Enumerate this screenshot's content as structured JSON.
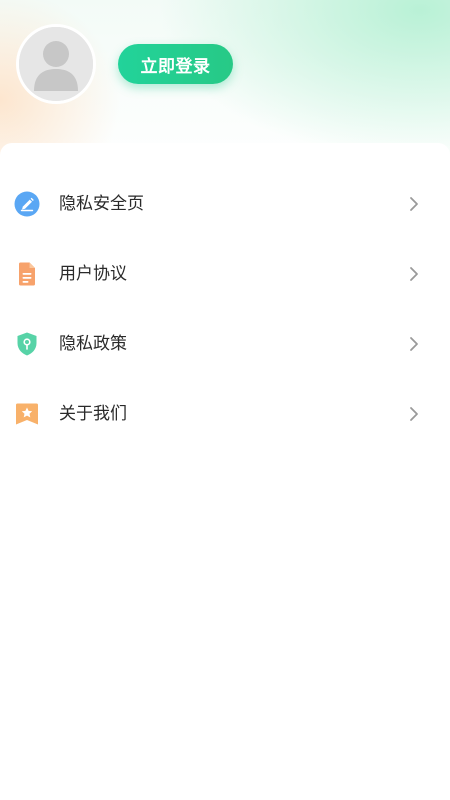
{
  "profile": {
    "login_label": "立即登录",
    "avatar_icon": "default-avatar-icon"
  },
  "menu": {
    "items": [
      {
        "label": "隐私安全页",
        "icon": "pencil-icon",
        "icon_color": "#5aa7f4"
      },
      {
        "label": "用户协议",
        "icon": "document-icon",
        "icon_color": "#f7a26b"
      },
      {
        "label": "隐私政策",
        "icon": "shield-icon",
        "icon_color": "#57d3a7"
      },
      {
        "label": "关于我们",
        "icon": "star-badge-icon",
        "icon_color": "#f8b16a"
      }
    ]
  },
  "colors": {
    "accent": "#22d39a",
    "chevron": "#9a9a9a"
  }
}
